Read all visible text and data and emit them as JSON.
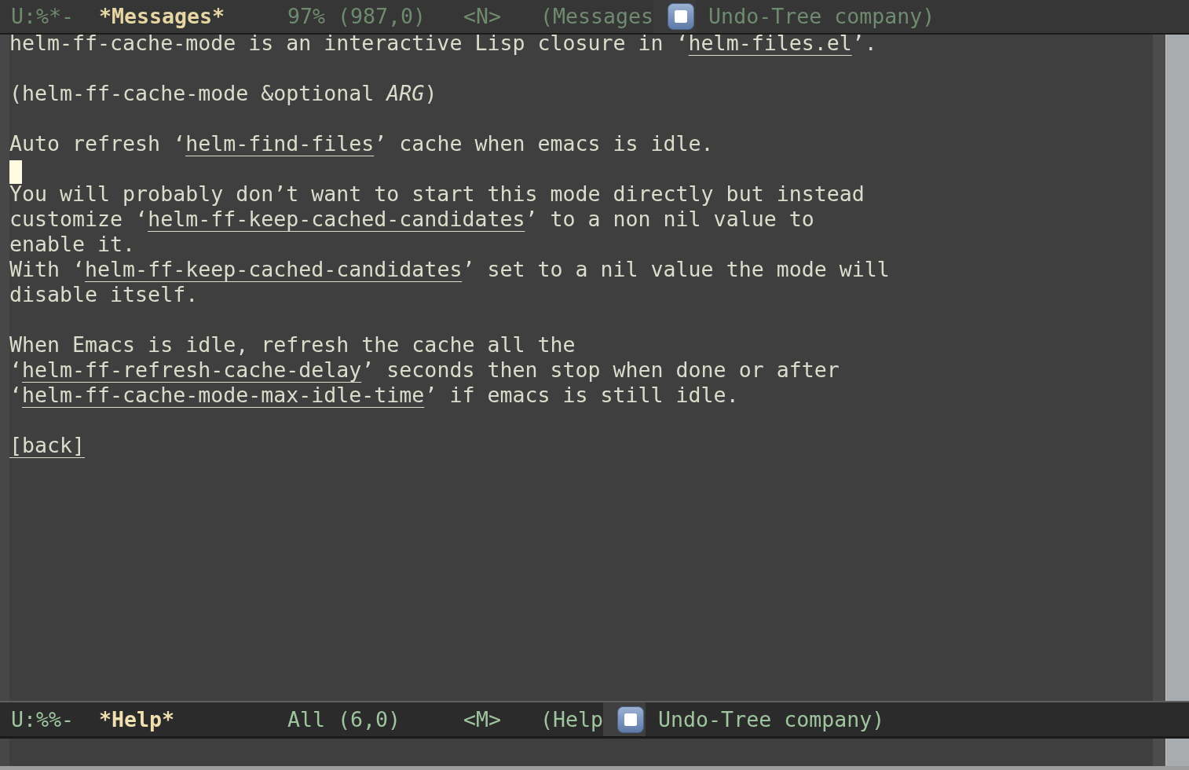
{
  "messages_mode_line": {
    "active": false,
    "status": "U:%*-",
    "buffer_name": "*Messages*",
    "position": "97% (987,0)",
    "state": "<N>",
    "major_mode": "(Messages",
    "minor_modes": "Undo-Tree company)"
  },
  "help_window": {
    "paragraphs": [
      {
        "cursor_below": false,
        "lines": [
          [
            {
              "kind": "text",
              "text": "helm-ff-cache-mode is an interactive Lisp closure in ‘"
            },
            {
              "kind": "link",
              "text": "helm-files.el"
            },
            {
              "kind": "text",
              "text": "’."
            }
          ]
        ]
      },
      {
        "cursor_below": false,
        "lines": [
          [
            {
              "kind": "text",
              "text": "(helm-ff-cache-mode &optional *ARG*)"
            }
          ]
        ]
      },
      {
        "cursor_below": true,
        "lines": [
          [
            {
              "kind": "text",
              "text": "Auto refresh ‘"
            },
            {
              "kind": "link",
              "text": "helm-find-files"
            },
            {
              "kind": "text",
              "text": "’ cache when emacs is idle."
            }
          ]
        ]
      },
      {
        "cursor_below": false,
        "lines": [
          [
            {
              "kind": "text",
              "text": "You will probably don’t want to start this mode directly but instead"
            }
          ],
          [
            {
              "kind": "text",
              "text": "customize ‘"
            },
            {
              "kind": "link",
              "text": "helm-ff-keep-cached-candidates"
            },
            {
              "kind": "text",
              "text": "’ to a non nil value to"
            }
          ],
          [
            {
              "kind": "text",
              "text": "enable it."
            }
          ],
          [
            {
              "kind": "text",
              "text": "With ‘"
            },
            {
              "kind": "link",
              "text": "helm-ff-keep-cached-candidates"
            },
            {
              "kind": "text",
              "text": "’ set to a nil value the mode will"
            }
          ],
          [
            {
              "kind": "text",
              "text": "disable itself."
            }
          ]
        ]
      },
      {
        "cursor_below": false,
        "lines": [
          [
            {
              "kind": "text",
              "text": "When Emacs is idle, refresh the cache all the"
            }
          ],
          [
            {
              "kind": "text",
              "text": "‘"
            },
            {
              "kind": "link",
              "text": "helm-ff-refresh-cache-delay"
            },
            {
              "kind": "text",
              "text": "’ seconds then stop when done or after"
            }
          ],
          [
            {
              "kind": "text",
              "text": "‘"
            },
            {
              "kind": "link",
              "text": "helm-ff-cache-mode-max-idle-time"
            },
            {
              "kind": "text",
              "text": "’ if emacs is still idle."
            }
          ]
        ]
      },
      {
        "cursor_below": false,
        "lines": [
          [
            {
              "kind": "link",
              "text": "[back]"
            }
          ]
        ]
      }
    ]
  },
  "help_mode_line": {
    "active": true,
    "status": "U:%%-",
    "buffer_name": "*Help*",
    "position": "All (6,0)",
    "state": "<M>",
    "major_mode": "(Help",
    "minor_modes": "Undo-Tree company)"
  }
}
